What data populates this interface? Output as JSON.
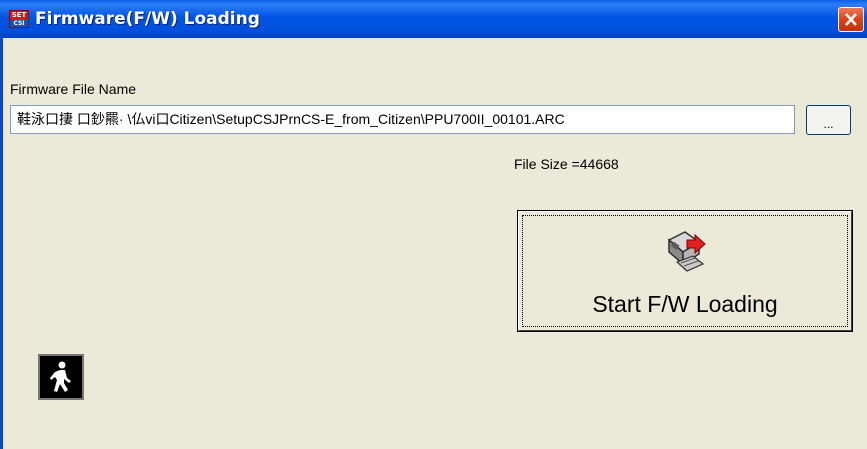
{
  "window": {
    "title": "Firmware(F/W) Loading",
    "icon_text_top": "SET",
    "icon_text_bottom": "CSI"
  },
  "firmware": {
    "label": "Firmware File Name",
    "value": "鞋泳口捿 口鈔羆· \\仏vi口Citizen\\SetupCSJPrnCS-E_from_Citizen\\PPU700II_00101.ARC",
    "browse_label": "...",
    "file_size_text": "File Size =44668"
  },
  "actions": {
    "start_label": "Start F/W Loading"
  },
  "icons": {
    "app": "app-icon",
    "close": "close-icon",
    "start": "computer-load-icon",
    "exit": "exit-walking-man-icon"
  },
  "colors": {
    "titlebar": "#0054E3",
    "window_bg": "#ECE9D8",
    "close_button": "#D9441C"
  }
}
